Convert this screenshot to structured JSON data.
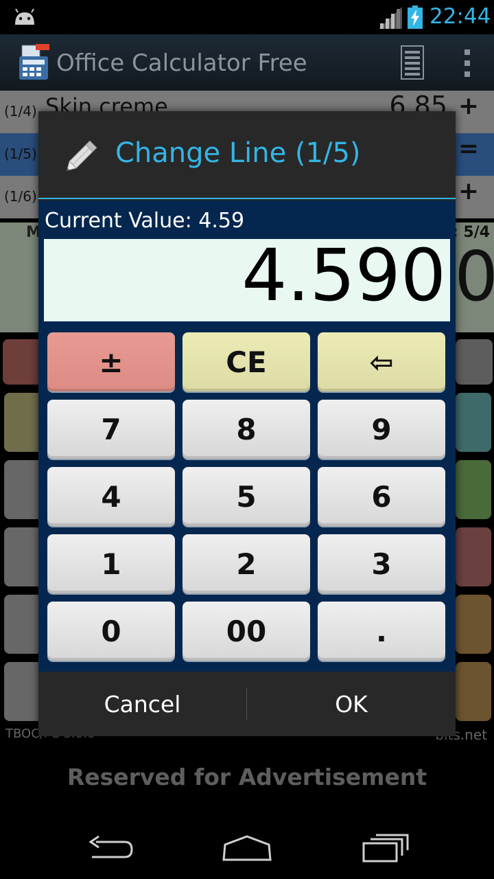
{
  "status_bar": {
    "time": "22:44"
  },
  "app": {
    "title": "Office Calculator Free",
    "footer_left": "TBOC/FC 3.0.0",
    "footer_right": "bits.net"
  },
  "background": {
    "rows": [
      {
        "index": "(1/4)",
        "name": "Skin creme",
        "value": "6.85",
        "op": "+"
      },
      {
        "index": "(1/5)",
        "name": "",
        "value": "",
        "op": "="
      },
      {
        "index": "(1/6)",
        "name": "",
        "value": "",
        "op": "+"
      }
    ],
    "count_label": ": 5/4",
    "m_label": "M",
    "big_value": "0"
  },
  "dialog": {
    "title": "Change Line (1/5)",
    "current_label": "Current Value: 4.59",
    "display_value": "4.590",
    "keys": [
      {
        "label": "±",
        "name": "sign-toggle-button",
        "style": "red"
      },
      {
        "label": "CE",
        "name": "clear-entry-button",
        "style": "yellow"
      },
      {
        "label": "⇦",
        "name": "backspace-button",
        "style": "yellow"
      },
      {
        "label": "7",
        "name": "digit-7-button",
        "style": "gray"
      },
      {
        "label": "8",
        "name": "digit-8-button",
        "style": "gray"
      },
      {
        "label": "9",
        "name": "digit-9-button",
        "style": "gray"
      },
      {
        "label": "4",
        "name": "digit-4-button",
        "style": "gray"
      },
      {
        "label": "5",
        "name": "digit-5-button",
        "style": "gray"
      },
      {
        "label": "6",
        "name": "digit-6-button",
        "style": "gray"
      },
      {
        "label": "1",
        "name": "digit-1-button",
        "style": "gray"
      },
      {
        "label": "2",
        "name": "digit-2-button",
        "style": "gray"
      },
      {
        "label": "3",
        "name": "digit-3-button",
        "style": "gray"
      },
      {
        "label": "0",
        "name": "digit-0-button",
        "style": "gray"
      },
      {
        "label": "00",
        "name": "double-zero-button",
        "style": "gray"
      },
      {
        "label": ".",
        "name": "decimal-point-button",
        "style": "gray"
      }
    ],
    "cancel_label": "Cancel",
    "ok_label": "OK"
  },
  "ad": {
    "text": "Reserved for Advertisement"
  },
  "colors": {
    "accent": "#33b5e5",
    "dialog_body": "#05274f",
    "display_bg": "#e9f9f1"
  },
  "icons": [
    "android-icon",
    "signal-icon",
    "battery-charging-icon",
    "app-icon",
    "tape-icon",
    "overflow-menu-icon",
    "pencil-icon",
    "back-icon",
    "home-icon",
    "recents-icon"
  ]
}
